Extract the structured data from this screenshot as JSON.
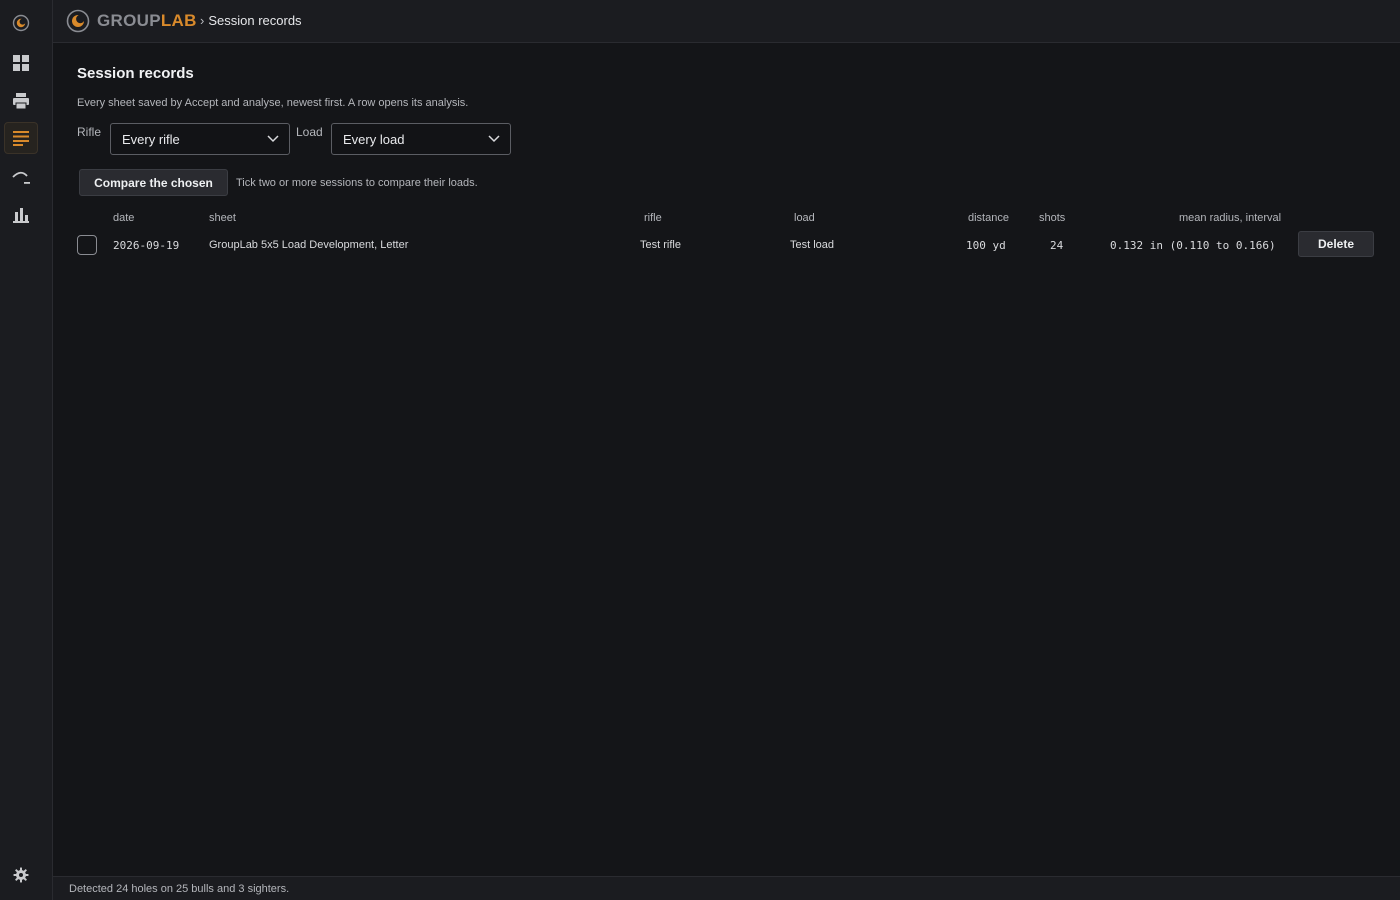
{
  "app": {
    "brand_part1": "GROUP",
    "brand_part2": "LAB",
    "breadcrumb_sep": "›",
    "breadcrumb_current": "Session records"
  },
  "rail": {
    "items": [
      {
        "icon": "logo-icon"
      },
      {
        "icon": "dashboard-grid-icon"
      },
      {
        "icon": "printer-icon"
      },
      {
        "icon": "list-icon",
        "active": true
      },
      {
        "icon": "trajectory-icon"
      },
      {
        "icon": "bar-chart-icon"
      }
    ],
    "bottom_icon": "gear-icon"
  },
  "page": {
    "title": "Session records",
    "description": "Every sheet saved by Accept and analyse, newest first. A row opens its analysis."
  },
  "filters": {
    "rifle_label": "Rifle",
    "rifle_value": "Every rifle",
    "load_label": "Load",
    "load_value": "Every load"
  },
  "compare": {
    "button_label": "Compare the chosen",
    "hint": "Tick two or more sessions to compare their loads."
  },
  "table": {
    "headers": {
      "date": "date",
      "sheet": "sheet",
      "rifle": "rifle",
      "load": "load",
      "distance": "distance",
      "shots": "shots",
      "mean_radius": "mean radius, interval"
    },
    "rows": [
      {
        "date": "2026-09-19",
        "sheet": "GroupLab 5x5 Load Development, Letter",
        "rifle": "Test rifle",
        "load": "Test load",
        "distance": "100 yd",
        "shots": "24",
        "mean_radius": "0.132 in (0.110 to 0.166)",
        "delete_label": "Delete",
        "checked": false
      }
    ]
  },
  "status": {
    "text": "Detected 24 holes on 25 bulls and 3 sighters."
  },
  "colors": {
    "accent": "#d98a2b",
    "background": "#141518",
    "panel": "#1b1c20"
  }
}
